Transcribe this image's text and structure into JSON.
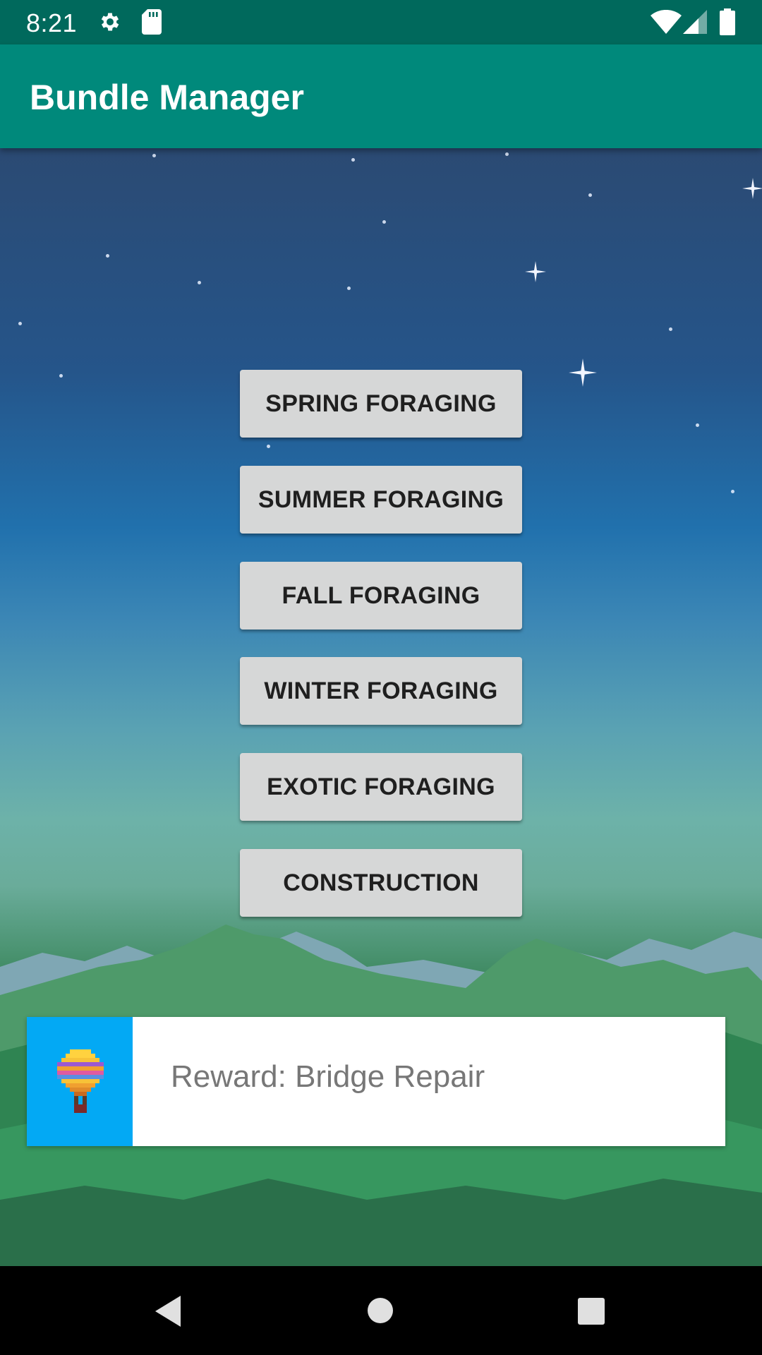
{
  "status_bar": {
    "time": "8:21",
    "icons": [
      "gear-icon",
      "sd-card-icon",
      "wifi-icon",
      "signal-icon",
      "battery-icon"
    ]
  },
  "app_bar": {
    "title": "Bundle Manager"
  },
  "bundles": [
    {
      "label": "SPRING FORAGING"
    },
    {
      "label": "SUMMER FORAGING"
    },
    {
      "label": "FALL FORAGING"
    },
    {
      "label": "WINTER FORAGING"
    },
    {
      "label": "EXOTIC FORAGING"
    },
    {
      "label": "CONSTRUCTION"
    }
  ],
  "reward": {
    "text": "Reward: Bridge Repair",
    "icon": "hot-air-balloon-icon"
  },
  "nav_bar": {
    "icons": [
      "back-icon",
      "home-icon",
      "recents-icon"
    ]
  },
  "colors": {
    "status_bar": "#00695c",
    "app_bar": "#00897b",
    "button": "#d6d7d7",
    "reward_icon_bg": "#03a9f4"
  }
}
